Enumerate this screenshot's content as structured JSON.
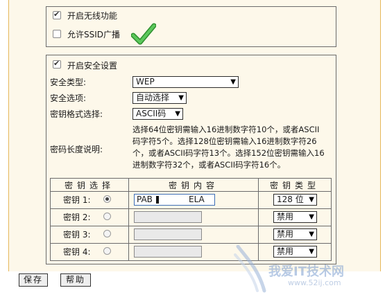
{
  "wireless": {
    "enable_wireless": "开启无线功能",
    "enable_wireless_checked": true,
    "ssid_broadcast": "允许SSID广播",
    "ssid_broadcast_checked": false
  },
  "security": {
    "enable_security": "开启安全设置",
    "enable_security_checked": true,
    "type_label": "安全类型:",
    "type_value": "WEP",
    "option_label": "安全选项:",
    "option_value": "自动选择",
    "format_label": "密钥格式选择:",
    "format_value": "ASCII码",
    "length_label": "密码长度说明:",
    "length_note": [
      "选择64位密钥需输入16进制数字符10个，或者ASCII",
      "码字符5个。选择128位密钥需输入16进制数字符26",
      "个，或者ASCII码字符13个。选择152位密钥需输入16",
      "进制数字符32个，或者ASCII码字符16个。"
    ]
  },
  "keys_table": {
    "headers": [
      "密钥选择",
      "密钥内容",
      "密钥类型"
    ],
    "rows": [
      {
        "label": "密钥 1:",
        "selected": true,
        "content": "PAB",
        "content_tail": "ELA",
        "type": "128 位"
      },
      {
        "label": "密钥 2:",
        "selected": false,
        "content": "",
        "type": "禁用"
      },
      {
        "label": "密钥 3:",
        "selected": false,
        "content": "",
        "type": "禁用"
      },
      {
        "label": "密钥 4:",
        "selected": false,
        "content": "",
        "type": "禁用"
      }
    ]
  },
  "actions": {
    "save": "保存",
    "help": "帮助"
  },
  "watermark": {
    "text": "我爱IT技术网",
    "url": "www.52ij.com"
  },
  "colors": {
    "panel_bg": "#fdf8ea",
    "frame_border": "#e6b75a",
    "checkmark_green": "#3aa63a"
  },
  "icons": [
    "checkbox-icon",
    "green-checkmark-icon",
    "dropdown-arrow-icon",
    "radio-icon"
  ]
}
